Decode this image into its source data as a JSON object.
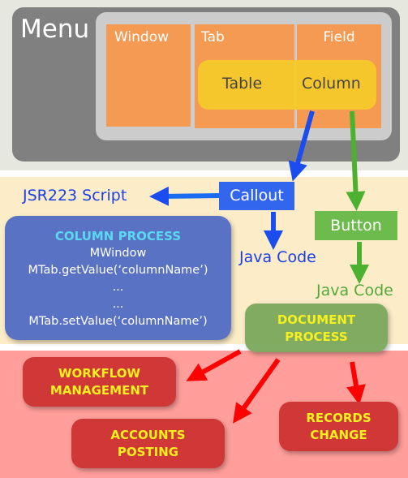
{
  "menu": {
    "label": "Menu",
    "columns": [
      "Window",
      "Tab",
      "Field"
    ],
    "highlight": [
      "Table",
      "Column"
    ]
  },
  "callout": {
    "label": "Callout",
    "script_label": "JSR223 Script",
    "java_label": "Java Code"
  },
  "button": {
    "label": "Button",
    "java_label": "Java Code"
  },
  "column_process": {
    "title": "COLUMN PROCESS",
    "lines": [
      "MWindow",
      "MTab.getValue(‘columnName’)",
      "...",
      "...",
      "MTab.setValue(‘columnName’)"
    ]
  },
  "document_process": {
    "line1": "DOCUMENT",
    "line2": "PROCESS"
  },
  "outputs": [
    {
      "line1": "WORKFLOW",
      "line2": "MANAGEMENT"
    },
    {
      "line1": "ACCOUNTS",
      "line2": "POSTING"
    },
    {
      "line1": "RECORDS",
      "line2": "CHANGE"
    }
  ],
  "colors": {
    "callout": "#3366ee",
    "button": "#6cbb4c",
    "arrow_red": "#ff0000",
    "orange": "#f59a52",
    "yellow": "#f6c92a"
  }
}
